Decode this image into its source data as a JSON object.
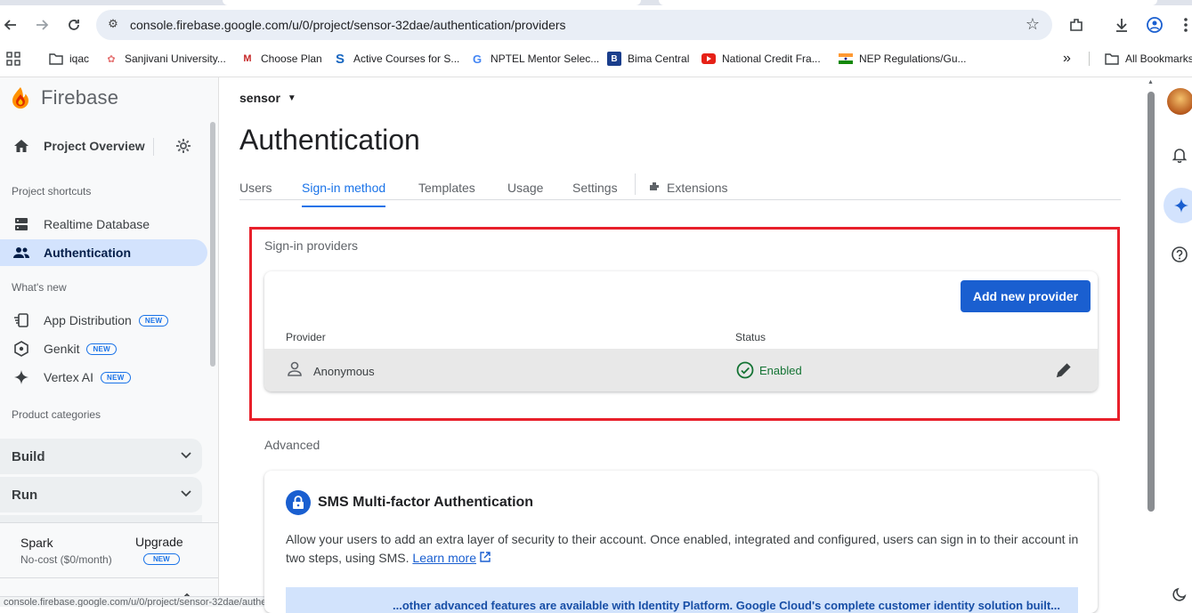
{
  "browser": {
    "url": "console.firebase.google.com/u/0/project/sensor-32dae/authentication/providers",
    "bookmarks": [
      {
        "label": "iqac",
        "icon": "folder-icon"
      },
      {
        "label": "Sanjivani University...",
        "icon": "lotus-icon"
      },
      {
        "label": "Choose Plan",
        "icon": "m-logo-icon"
      },
      {
        "label": "Active Courses for S...",
        "icon": "s-logo-icon"
      },
      {
        "label": "NPTEL Mentor Selec...",
        "icon": "google-icon"
      },
      {
        "label": "Bima Central",
        "icon": "b-logo-icon"
      },
      {
        "label": "National Credit Fra...",
        "icon": "youtube-icon"
      },
      {
        "label": "NEP Regulations/Gu...",
        "icon": "india-flag-icon"
      }
    ],
    "all_bookmarks": "All Bookmarks"
  },
  "sidebar": {
    "brand": "Firebase",
    "project_overview": "Project Overview",
    "shortcuts_label": "Project shortcuts",
    "shortcuts": [
      {
        "label": "Realtime Database",
        "icon": "database-icon"
      },
      {
        "label": "Authentication",
        "icon": "people-icon",
        "active": true
      }
    ],
    "whats_new_label": "What's new",
    "whats_new": [
      {
        "label": "App Distribution",
        "badge": "NEW",
        "icon": "app-distribution-icon"
      },
      {
        "label": "Genkit",
        "badge": "NEW",
        "icon": "genkit-icon"
      },
      {
        "label": "Vertex AI",
        "badge": "NEW",
        "icon": "sparkle-icon"
      }
    ],
    "categories_label": "Product categories",
    "categories": [
      "Build",
      "Run"
    ],
    "plan": "Spark",
    "plan_sub": "No-cost ($0/month)",
    "upgrade": "Upgrade",
    "upgrade_badge": "NEW",
    "status_url": "console.firebase.google.com/u/0/project/sensor-32dae/authentication/providers"
  },
  "main": {
    "project": "sensor",
    "title": "Authentication",
    "tabs": [
      "Users",
      "Sign-in method",
      "Templates",
      "Usage",
      "Settings",
      "Extensions"
    ],
    "active_tab": "Sign-in method",
    "sign_in_label": "Sign-in providers",
    "add_provider": "Add new provider",
    "col_provider": "Provider",
    "col_status": "Status",
    "providers": [
      {
        "name": "Anonymous",
        "status": "Enabled"
      }
    ],
    "advanced_label": "Advanced",
    "sms_title": "SMS Multi-factor Authentication",
    "sms_desc": "Allow your users to add an extra layer of security to their account. Once enabled, integrated and configured, users can sign in to their account in two steps, using SMS.",
    "learn_more": "Learn more",
    "banner": "...other advanced features are available with Identity Platform. Google Cloud's complete customer identity solution built..."
  },
  "colors": {
    "accent": "#1a73e8",
    "button": "#1a5fd0",
    "highlight_box": "#e8202b",
    "enabled": "#137333"
  }
}
